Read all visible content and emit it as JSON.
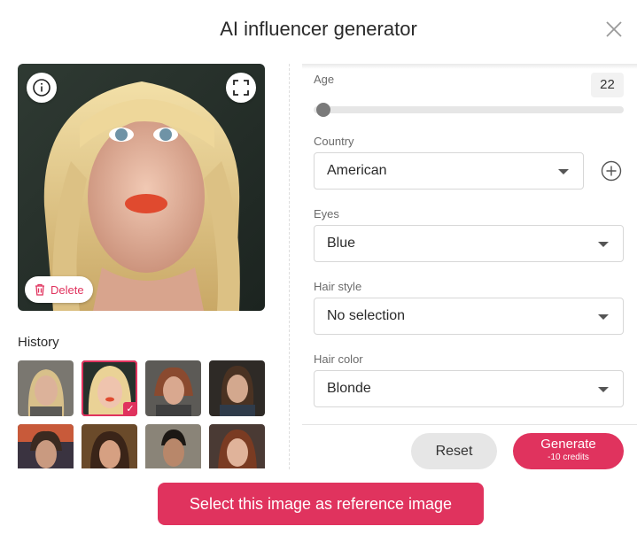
{
  "dialog": {
    "title": "AI influencer generator"
  },
  "preview": {
    "delete_label": "Delete"
  },
  "history": {
    "label": "History",
    "selected_index": 1,
    "count": 8
  },
  "form": {
    "age": {
      "label": "Age",
      "value": "22",
      "slider_fraction": 0.07
    },
    "country": {
      "label": "Country",
      "value": "American"
    },
    "eyes": {
      "label": "Eyes",
      "value": "Blue"
    },
    "hair_style": {
      "label": "Hair style",
      "value": "No selection"
    },
    "hair_color": {
      "label": "Hair color",
      "value": "Blonde"
    }
  },
  "actions": {
    "reset_label": "Reset",
    "generate_label": "Generate",
    "generate_sub": "-10 credits",
    "reference_label": "Select this image as reference image"
  },
  "colors": {
    "accent": "#e0335e",
    "reset_bg": "#e6e6e6"
  },
  "icons": [
    "close-icon",
    "info-icon",
    "expand-icon",
    "trash-icon",
    "plus-circle-icon",
    "chevron-down-icon",
    "check-icon"
  ]
}
